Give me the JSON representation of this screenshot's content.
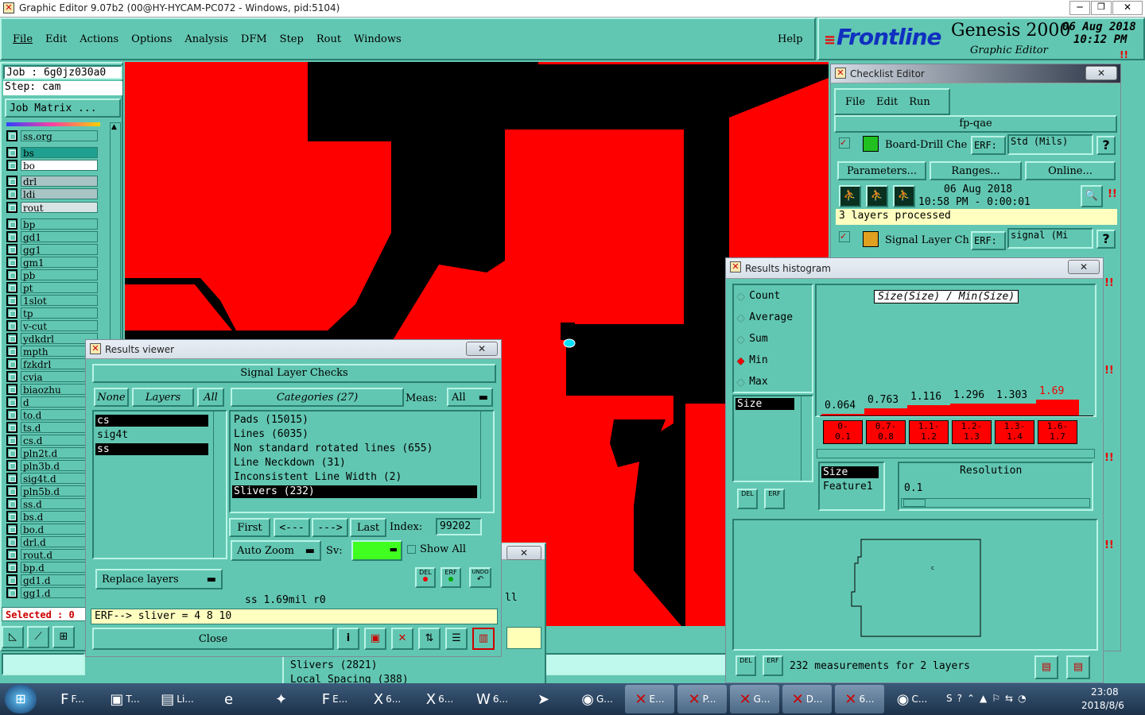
{
  "window": {
    "title": "Graphic Editor 9.07b2 (00@HY-HYCAM-PC072 - Windows, pid:5104)"
  },
  "menu": [
    "File",
    "Edit",
    "Actions",
    "Options",
    "Analysis",
    "DFM",
    "Step",
    "Rout",
    "Windows"
  ],
  "help": "Help",
  "brand": {
    "logo": "Frontline",
    "product": "Genesis 2000",
    "subtitle": "Graphic Editor",
    "date": "06 Aug 2018",
    "time": "10:12 PM"
  },
  "job": {
    "job": "Job : 6g0jz030a0",
    "step": "Step: cam",
    "matrix": "Job Matrix ..."
  },
  "layers": [
    "ss.org",
    "bs",
    "bo",
    "drl",
    "ldi",
    "rout",
    "bp",
    "gd1",
    "gg1",
    "gm1",
    "pb",
    "pt",
    "1slot",
    "tp",
    "v-cut",
    "ydkdrl",
    "mpth",
    "fzkdrl",
    "cvia",
    "biaozhu",
    "d",
    "to.d",
    "ts.d",
    "cs.d",
    "pln2t.d",
    "pln3b.d",
    "sig4t.d",
    "pln5b.d",
    "ss.d",
    "bs.d",
    "bo.d",
    "drl.d",
    "rout.d",
    "bp.d",
    "gd1.d",
    "gg1.d"
  ],
  "selected": "Selected : 0",
  "checklist": {
    "title": "Checklist Editor",
    "menu": [
      "File",
      "Edit",
      "Run"
    ],
    "name": "fp-qae",
    "item1": {
      "label": "Board-Drill Che",
      "erf": "ERF:",
      "erfval": "Std (Mils)",
      "q": "?"
    },
    "buttons": [
      "Parameters...",
      "Ranges...",
      "Online..."
    ],
    "run_date": "06 Aug 2018",
    "run_time": "10:58 PM - 0:00:01",
    "status": "3 layers processed",
    "item2": {
      "label": "Signal Layer Ch",
      "erf": "ERF:",
      "erfval": "signal (Mi",
      "q": "?"
    }
  },
  "results_viewer": {
    "title": "Results viewer",
    "header": "Signal Layer Checks",
    "none": "None",
    "layers": "Layers",
    "all": "All",
    "layer_list": [
      "cs",
      "sig4t",
      "ss"
    ],
    "categories_label": "Categories (27)",
    "meas_label": "Meas:",
    "meas_val": "All",
    "categories": [
      "Pads (15015)",
      "Lines (6035)",
      "Non standard rotated lines (655)",
      "Line Neckdown (31)",
      "Inconsistent Line Width (2)",
      "Slivers (232)"
    ],
    "first": "First",
    "prev": "<---",
    "next": "--->",
    "last": "Last",
    "index_label": "Index:",
    "index_val": "99202",
    "autozoom": "Auto Zoom",
    "sv": "Sv:",
    "showall": "Show All",
    "replace": "Replace layers",
    "del": "DEL",
    "erf": "ERF",
    "undo": "UNDO",
    "status": "ss 1.69mil r0",
    "erfline": "ERF--> sliver = 4 8 10",
    "close": "Close"
  },
  "behind": {
    "line1": "Slivers (2821)",
    "line2": "Local Spacing (388)",
    "ll": "ll"
  },
  "histogram": {
    "title": "Results histogram",
    "modes": [
      "Count",
      "Average",
      "Sum",
      "Min",
      "Max"
    ],
    "selected_mode": "Min",
    "chart_title": "Size(Size) / Min(Size)",
    "left_label": "Size",
    "values": [
      "0.064",
      "0.763",
      "1.116",
      "1.296",
      "1.303",
      "1.69"
    ],
    "ranges": [
      "0-\n0.1",
      "0.7-\n0.8",
      "1.1-\n1.2",
      "1.2-\n1.3",
      "1.3-\n1.4",
      "1.6-\n1.7"
    ],
    "list2": [
      "Size",
      "Feature1"
    ],
    "resolution_label": "Resolution",
    "resolution_val": "0.1",
    "footer": "232 measurements for 2 layers",
    "del": "DEL",
    "erf": "ERF"
  },
  "taskbar": {
    "items": [
      "F...",
      "T...",
      "Li...",
      "",
      "",
      "E...",
      "6...",
      "6...",
      "6...",
      "",
      "G...",
      "E...",
      "P...",
      "G...",
      "D...",
      "6...",
      "C..."
    ],
    "time": "23:08",
    "date": "2018/8/6"
  }
}
